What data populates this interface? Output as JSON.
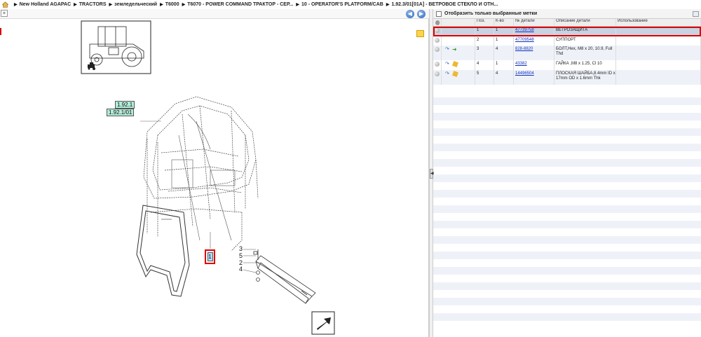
{
  "breadcrumb": {
    "items": [
      "New Holland AGAPAC",
      "TRACTORS",
      "земледельческий",
      "T6000",
      "T6070 - POWER COMMAND ТРАКТОР - СЕР...",
      "10 - OPERATOR'S PLATFORM/CAB",
      "1.92.3/01[01A] - ВЕТРОВОЕ СТЕКЛО И ОТН..."
    ]
  },
  "toolbar": {
    "expand_label": "+",
    "back_label": "◀",
    "forward_label": "▶"
  },
  "diagram": {
    "callouts": [
      "1.92.1",
      "1.92.1/01"
    ],
    "part_tags": [
      "3",
      "5",
      "2",
      "4"
    ],
    "selected_tag": "1"
  },
  "filter": {
    "label": "Отобразить только выбранные метки",
    "checked": false
  },
  "table": {
    "columns": [
      "",
      "",
      "Поз.",
      "К-во",
      "№ детали",
      "Описание детали",
      "Использование"
    ],
    "rows": [
      {
        "pos": "1",
        "qty": "1",
        "part": "47739758",
        "desc": "ВЕТРОЗАЩИТА",
        "usage": "",
        "icons": []
      },
      {
        "pos": "2",
        "qty": "1",
        "part": "47709548",
        "desc": "СУППОРТ",
        "usage": "",
        "icons": []
      },
      {
        "pos": "3",
        "qty": "4",
        "part": "828-8820",
        "desc": "БОЛТ,Hex, M8 x 20, 10.9, Full Thd",
        "usage": "",
        "icons": [
          "arrow",
          "green"
        ]
      },
      {
        "pos": "4",
        "qty": "1",
        "part": "43382",
        "desc": "ГАЙКА ,M8 x 1.25, Cl 10",
        "usage": "",
        "icons": [
          "arrow",
          "yellow"
        ]
      },
      {
        "pos": "5",
        "qty": "4",
        "part": "14496504",
        "desc": "ПЛОСКАЯ ШАЙБА,8.4mm ID x 17mm OD x 1.6mm Thk",
        "usage": "",
        "icons": [
          "arrow",
          "yellow"
        ]
      }
    ]
  },
  "splitter": {
    "handle_label": "◀"
  }
}
